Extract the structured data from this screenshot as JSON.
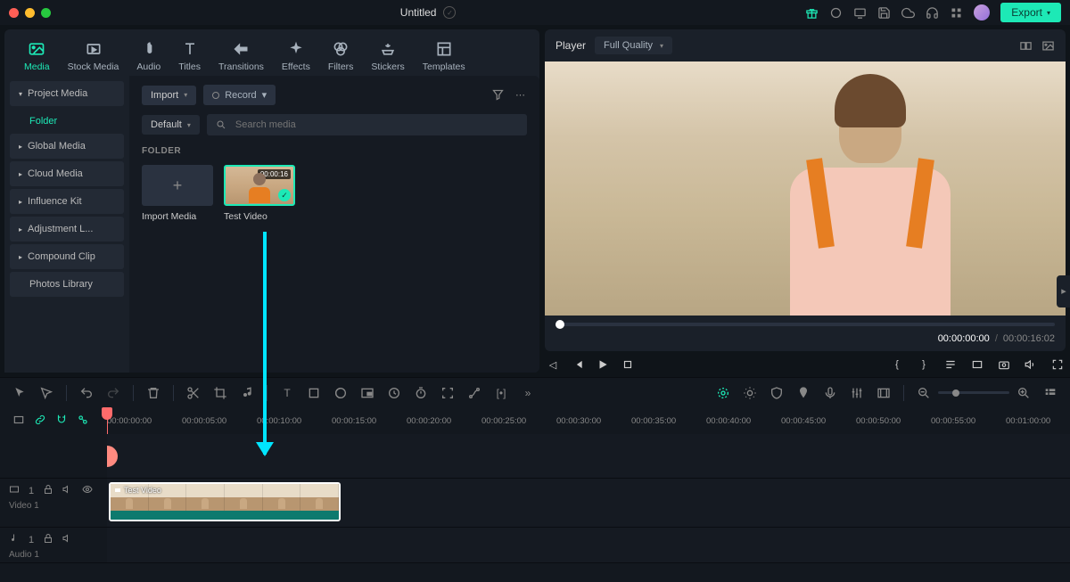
{
  "title": "Untitled",
  "export": "Export",
  "tabs": [
    {
      "label": "Media",
      "active": true
    },
    {
      "label": "Stock Media"
    },
    {
      "label": "Audio"
    },
    {
      "label": "Titles"
    },
    {
      "label": "Transitions"
    },
    {
      "label": "Effects"
    },
    {
      "label": "Filters"
    },
    {
      "label": "Stickers"
    },
    {
      "label": "Templates"
    }
  ],
  "sidebar": {
    "items": [
      {
        "label": "Project Media",
        "state": "expanded"
      },
      {
        "label": "Global Media",
        "state": "collapsed"
      },
      {
        "label": "Cloud Media",
        "state": "collapsed"
      },
      {
        "label": "Influence Kit",
        "state": "collapsed"
      },
      {
        "label": "Adjustment L...",
        "state": "collapsed"
      },
      {
        "label": "Compound Clip",
        "state": "collapsed"
      },
      {
        "label": "Photos Library",
        "state": "none"
      }
    ],
    "sub": "Folder"
  },
  "content": {
    "import": "Import",
    "record": "Record",
    "sort": "Default",
    "search_placeholder": "Search media",
    "section": "FOLDER",
    "importMedia": "Import Media",
    "clip": {
      "name": "Test Video",
      "duration": "00:00:16"
    }
  },
  "player": {
    "label": "Player",
    "quality": "Full Quality",
    "current": "00:00:00:00",
    "total": "00:00:16:02"
  },
  "timeline": {
    "ticks": [
      "00:00:00:00",
      "00:00:05:00",
      "00:00:10:00",
      "00:00:15:00",
      "00:00:20:00",
      "00:00:25:00",
      "00:00:30:00",
      "00:00:35:00",
      "00:00:40:00",
      "00:00:45:00",
      "00:00:50:00",
      "00:00:55:00",
      "00:01:00:00"
    ],
    "tracks": {
      "video": "Video 1",
      "audio": "Audio 1"
    },
    "clip": "Test Video"
  }
}
